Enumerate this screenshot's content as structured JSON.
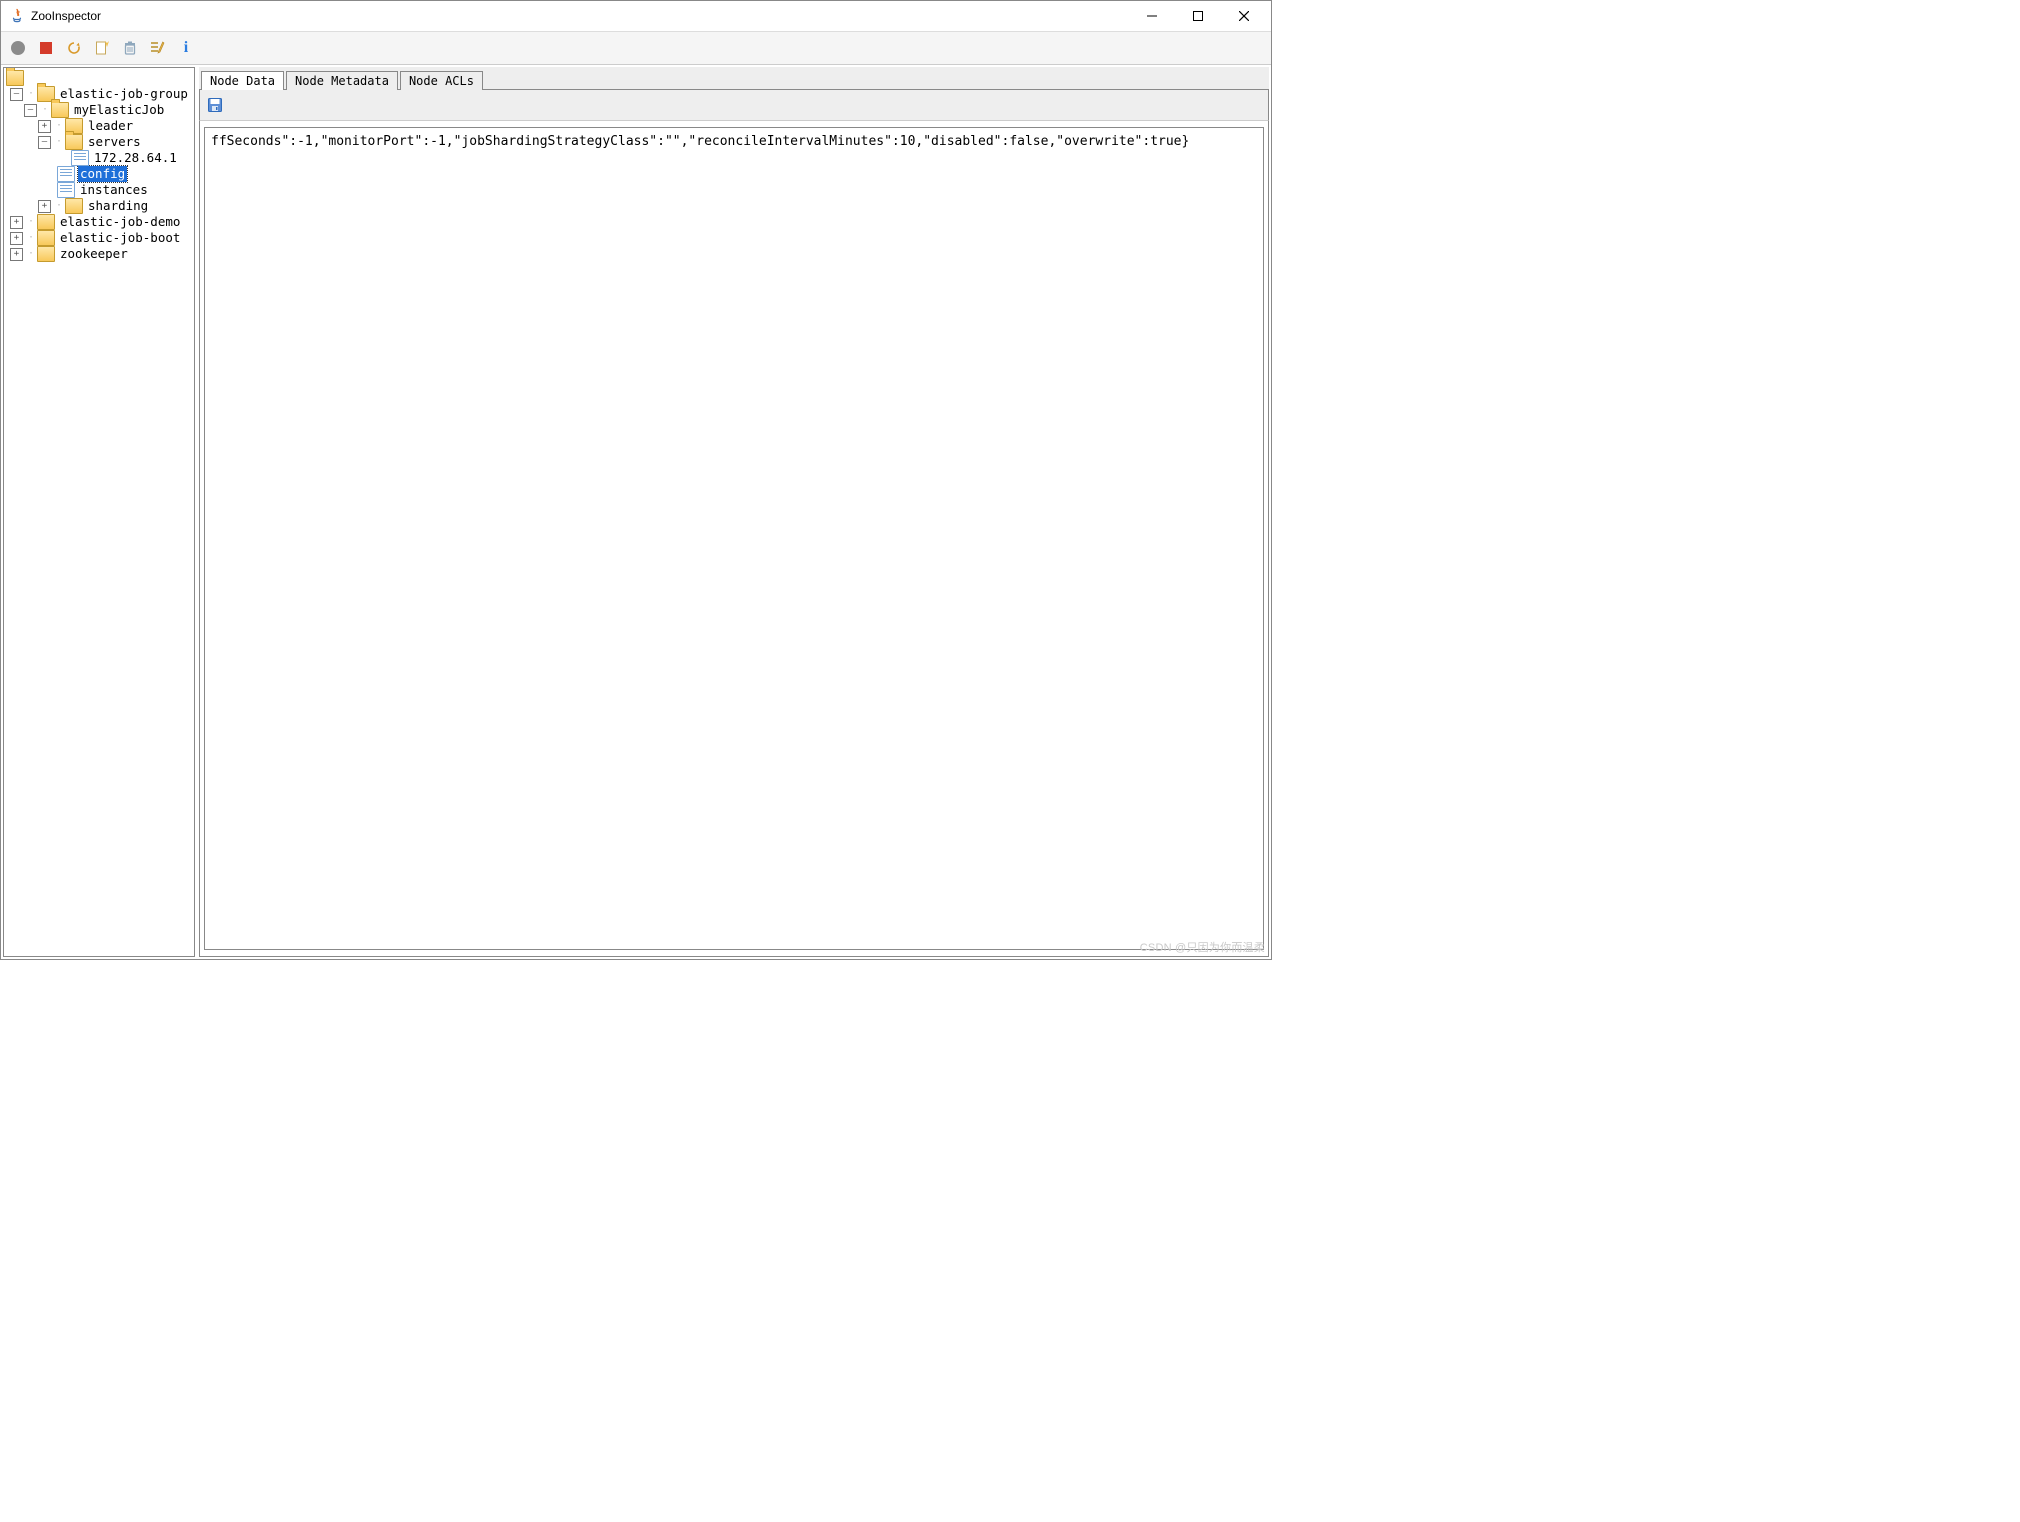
{
  "window": {
    "title": "ZooInspector"
  },
  "toolbar": {
    "connect": "connect-icon",
    "disconnect": "disconnect-icon",
    "refresh": "refresh-icon",
    "new": "new-node-icon",
    "delete": "delete-node-icon",
    "edit": "edit-watches-icon",
    "info": "info-icon"
  },
  "tree": {
    "root": {
      "label": "",
      "children": [
        {
          "label": "elastic-job-group",
          "expanded": true,
          "type": "folder",
          "children": [
            {
              "label": "myElasticJob",
              "expanded": true,
              "type": "folder",
              "children": [
                {
                  "label": "leader",
                  "type": "folder",
                  "expanded": false,
                  "hasChildren": true
                },
                {
                  "label": "servers",
                  "type": "folder",
                  "expanded": true,
                  "children": [
                    {
                      "label": "172.28.64.1",
                      "type": "file"
                    }
                  ]
                },
                {
                  "label": "config",
                  "type": "file",
                  "selected": true
                },
                {
                  "label": "instances",
                  "type": "file"
                },
                {
                  "label": "sharding",
                  "type": "folder",
                  "expanded": false,
                  "hasChildren": true
                }
              ]
            }
          ]
        },
        {
          "label": "elastic-job-demo",
          "type": "folder",
          "expanded": false,
          "hasChildren": true
        },
        {
          "label": "elastic-job-boot",
          "type": "folder",
          "expanded": false,
          "hasChildren": true
        },
        {
          "label": "zookeeper",
          "type": "folder",
          "expanded": false,
          "hasChildren": true
        }
      ]
    }
  },
  "tabs": {
    "active": 0,
    "items": [
      {
        "id": "node-data",
        "label": "Node Data"
      },
      {
        "id": "node-metadata",
        "label": "Node Metadata"
      },
      {
        "id": "node-acls",
        "label": "Node ACLs"
      }
    ]
  },
  "subtoolbar": {
    "save": "save-icon"
  },
  "node_data": {
    "text": "ffSeconds\":-1,\"monitorPort\":-1,\"jobShardingStrategyClass\":\"\",\"reconcileIntervalMinutes\":10,\"disabled\":false,\"overwrite\":true}"
  },
  "watermark": "CSDN @只因为你而温柔"
}
